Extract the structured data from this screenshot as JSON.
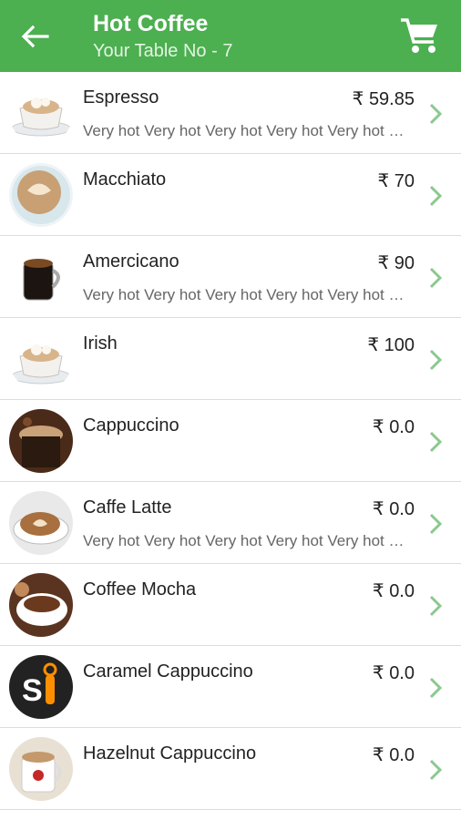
{
  "header": {
    "title": "Hot Coffee",
    "subtitle": "Your Table No - 7",
    "back_icon": "arrow-left-icon",
    "cart_icon": "shopping-cart-icon"
  },
  "colors": {
    "primary": "#4caf50",
    "chevron": "#8bc98e"
  },
  "items": [
    {
      "name": "Espresso",
      "price": "₹ 59.85",
      "desc": "Very hot Very hot Very hot Very hot Very hot Very hot"
    },
    {
      "name": "Macchiato",
      "price": "₹ 70",
      "desc": ""
    },
    {
      "name": "Amercicano",
      "price": "₹ 90",
      "desc": "Very hot Very hot Very hot Very hot Very hot Very hot"
    },
    {
      "name": "Irish",
      "price": "₹ 100",
      "desc": ""
    },
    {
      "name": "Cappuccino",
      "price": "₹ 0.0",
      "desc": ""
    },
    {
      "name": "Caffe Latte",
      "price": "₹ 0.0",
      "desc": "Very hot Very hot Very hot Very hot Very hot Very hot"
    },
    {
      "name": "Coffee Mocha",
      "price": "₹ 0.0",
      "desc": ""
    },
    {
      "name": "Caramel Cappuccino",
      "price": "₹ 0.0",
      "desc": ""
    },
    {
      "name": "Hazelnut Cappuccino",
      "price": "₹ 0.0",
      "desc": ""
    }
  ]
}
